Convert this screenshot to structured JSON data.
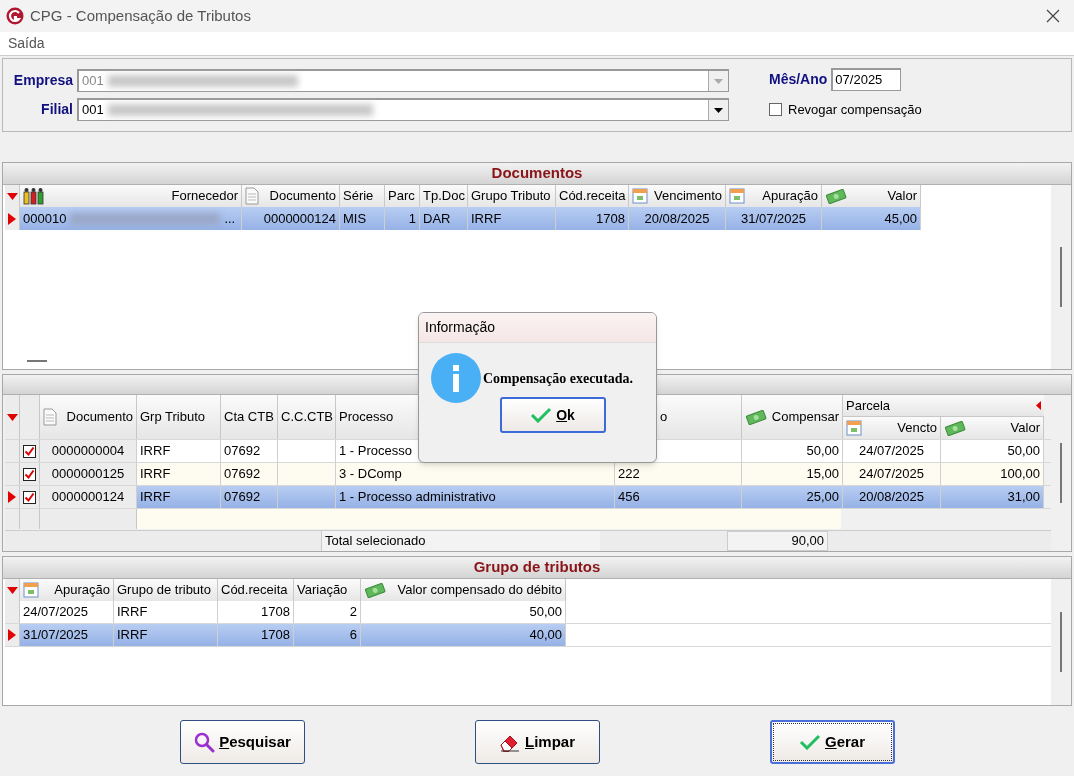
{
  "window": {
    "title": "CPG - Compensação de Tributos"
  },
  "menu": [
    "Saída"
  ],
  "filters": {
    "empresa": {
      "label": "Empresa",
      "value": "001",
      "disabled": true
    },
    "filial": {
      "label": "Filial",
      "value": "001",
      "disabled": false
    },
    "mes_ano": {
      "label": "Mês/Ano",
      "value": "07/2025"
    },
    "revogar": {
      "label": "Revogar compensação",
      "checked": false
    }
  },
  "documentos": {
    "title": "Documentos",
    "columns": [
      {
        "label": "Fornecedor",
        "kind": "people"
      },
      {
        "label": "Documento",
        "kind": "document"
      },
      {
        "label": "Série",
        "kind": "plain"
      },
      {
        "label": "Parc",
        "kind": "plain"
      },
      {
        "label": "Tp.Doc",
        "kind": "plain"
      },
      {
        "label": "Grupo Tributo",
        "kind": "plain"
      },
      {
        "label": "Cód.receita",
        "kind": "plain"
      },
      {
        "label": "Vencimento",
        "kind": "calendar"
      },
      {
        "label": "Apuração",
        "kind": "calendar"
      },
      {
        "label": "Valor",
        "kind": "money"
      }
    ],
    "rows": [
      {
        "selected": true,
        "ellipsis": "...",
        "cells": [
          "000010",
          "0000000124",
          "MIS",
          "1",
          "DAR",
          "IRRF",
          "1708",
          "20/08/2025",
          "31/07/2025",
          "45,00"
        ]
      }
    ]
  },
  "compensacoes": {
    "columns": [
      {
        "label": "Documento",
        "kind": "document"
      },
      {
        "label": "Grp Tributo",
        "kind": "plain"
      },
      {
        "label": "Cta CTB",
        "kind": "plain"
      },
      {
        "label": "C.C.CTB",
        "kind": "plain"
      },
      {
        "label": "Processo",
        "kind": "plain"
      },
      {
        "label": "o",
        "kind": "plain"
      },
      {
        "label": "Compensar",
        "kind": "money"
      }
    ],
    "parcela": {
      "label": "Parcela",
      "columns": [
        {
          "label": "Vencto",
          "kind": "calendar"
        },
        {
          "label": "Valor",
          "kind": "money"
        }
      ]
    },
    "rows": [
      {
        "checked": true,
        "selected": false,
        "cells": [
          "0000000004",
          "IRRF",
          "07692",
          null,
          "1 - Processo",
          null,
          "50,00",
          "24/07/2025",
          "50,00"
        ]
      },
      {
        "checked": true,
        "selected": false,
        "cells": [
          "0000000125",
          "IRRF",
          "07692",
          null,
          "3 - DComp",
          "222",
          "15,00",
          "24/07/2025",
          "100,00"
        ]
      },
      {
        "checked": true,
        "selected": true,
        "cells": [
          "0000000124",
          "IRRF",
          "07692",
          null,
          "1 - Processo administrativo",
          "456",
          "25,00",
          "20/08/2025",
          "31,00"
        ]
      }
    ],
    "total_label": "Total selecionado",
    "total_value": "90,00"
  },
  "grupo": {
    "title": "Grupo de tributos",
    "columns": [
      {
        "label": "Apuração",
        "kind": "calendar"
      },
      {
        "label": "Grupo de tributo",
        "kind": "plain"
      },
      {
        "label": "Cód.receita",
        "kind": "plain"
      },
      {
        "label": "Variação",
        "kind": "plain"
      },
      {
        "label": "Valor compensado do débito",
        "kind": "money"
      }
    ],
    "rows": [
      {
        "selected": false,
        "cells": [
          "24/07/2025",
          "IRRF",
          "1708",
          "2",
          "50,00"
        ]
      },
      {
        "selected": true,
        "cells": [
          "31/07/2025",
          "IRRF",
          "1708",
          "6",
          "40,00"
        ]
      }
    ]
  },
  "buttons": [
    {
      "label": "Pesquisar",
      "kind": "search",
      "default": false
    },
    {
      "label": "Limpar",
      "kind": "eraser",
      "default": false
    },
    {
      "label": "Gerar",
      "kind": "check",
      "default": true
    }
  ],
  "dialog": {
    "title": "Informação",
    "message": "Compensação executada.",
    "button": "Ok"
  }
}
